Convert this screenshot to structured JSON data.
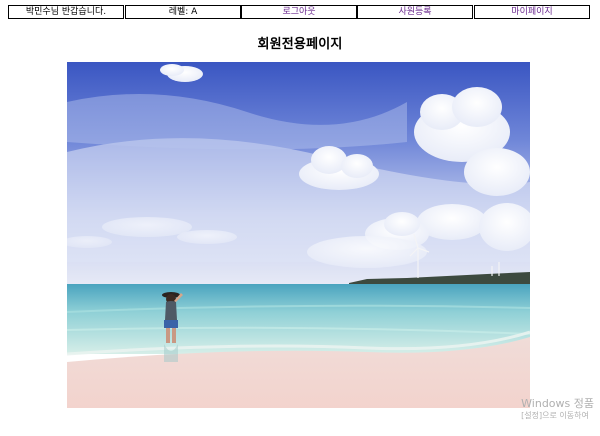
{
  "nav": {
    "greeting": "박민수님 반갑습니다.",
    "level": "레벨: A",
    "logout": "로그아웃",
    "register_employee": "사원등록",
    "mypage": "마이페이지"
  },
  "page": {
    "title": "회원전용페이지"
  },
  "watermark": {
    "line1": "Windows 정품",
    "line2": "[설정]으로 이동하여"
  },
  "colors": {
    "link": "#6b2a8f",
    "border": "#000000"
  }
}
